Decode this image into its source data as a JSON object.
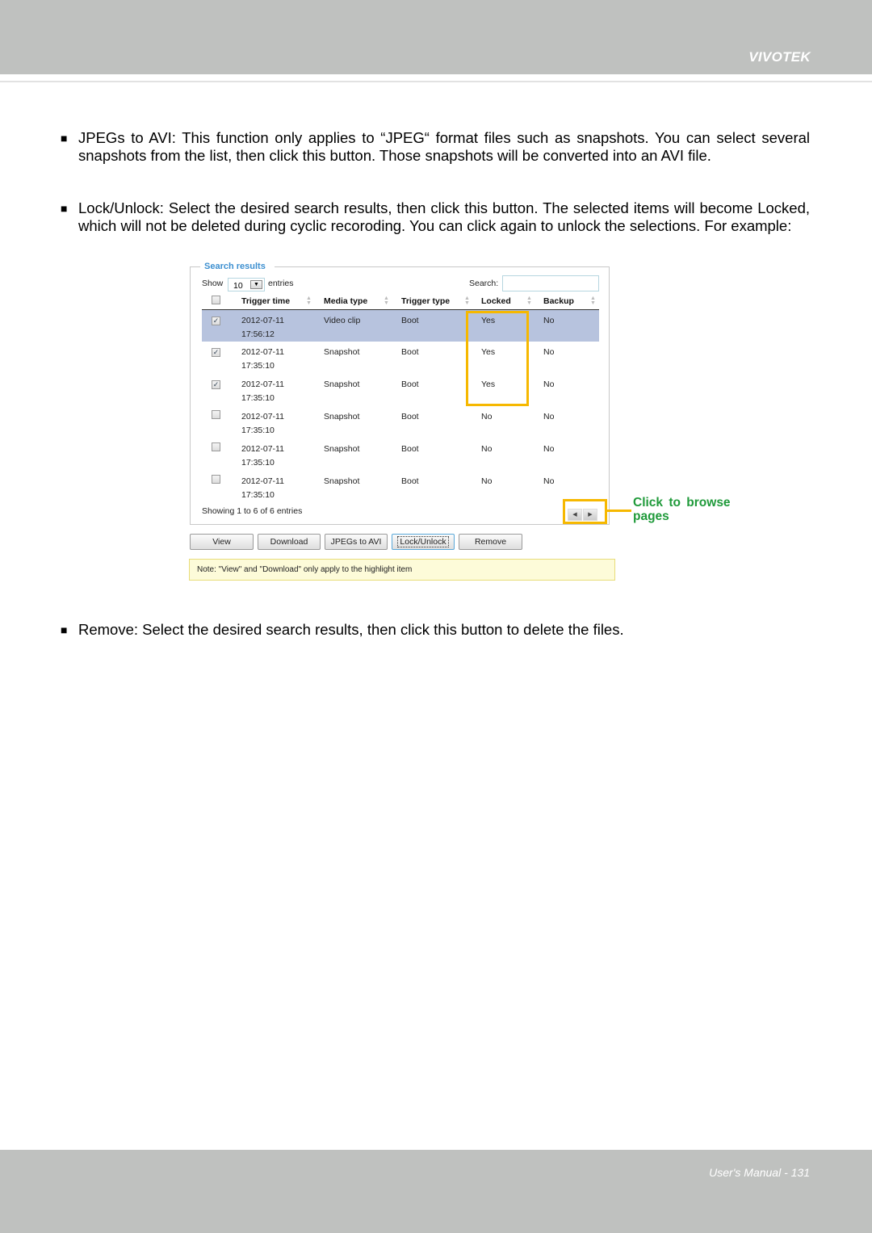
{
  "header": {
    "brand": "VIVOTEK"
  },
  "paragraphs": [
    {
      "bullet": "■",
      "text": "JPEGs to AVI: This function only applies to “JPEG“ format files such as snapshots. You can select several snapshots from the list, then click this button. Those snapshots will be converted into an AVI file."
    },
    {
      "bullet": "■",
      "text": "Lock/Unlock: Select the desired search results, then click this button. The selected items will become Locked, which will not be deleted during cyclic recoroding. You can click again to unlock the selections. For example:"
    },
    {
      "bullet": "■",
      "text": "Remove: Select the desired search results, then click this button to delete the files."
    }
  ],
  "search_panel": {
    "title": "Search results",
    "show_label": "Show",
    "entries_value": "10",
    "entries_label": "entries",
    "search_label": "Search:",
    "search_value": "",
    "columns": [
      "Trigger time",
      "Media type",
      "Trigger type",
      "Locked",
      "Backup"
    ],
    "rows": [
      {
        "checked": "✓",
        "date": "2012-07-11",
        "time": "17:56:12",
        "media": "Video clip",
        "trigger": "Boot",
        "locked": "Yes",
        "backup": "No"
      },
      {
        "checked": "✓",
        "date": "2012-07-11",
        "time": "17:35:10",
        "media": "Snapshot",
        "trigger": "Boot",
        "locked": "Yes",
        "backup": "No"
      },
      {
        "checked": "✓",
        "date": "2012-07-11",
        "time": "17:35:10",
        "media": "Snapshot",
        "trigger": "Boot",
        "locked": "Yes",
        "backup": "No"
      },
      {
        "checked": "",
        "date": "2012-07-11",
        "time": "17:35:10",
        "media": "Snapshot",
        "trigger": "Boot",
        "locked": "No",
        "backup": "No"
      },
      {
        "checked": "",
        "date": "2012-07-11",
        "time": "17:35:10",
        "media": "Snapshot",
        "trigger": "Boot",
        "locked": "No",
        "backup": "No"
      },
      {
        "checked": "",
        "date": "2012-07-11",
        "time": "17:35:10",
        "media": "Snapshot",
        "trigger": "Boot",
        "locked": "No",
        "backup": "No"
      }
    ],
    "showing_info": "Showing 1 to 6 of 6 entries",
    "pager": {
      "prev": "◀",
      "next": "▶"
    }
  },
  "callout": {
    "line1": "Click to browse",
    "line2": "pages"
  },
  "buttons": {
    "view": "View",
    "download": "Download",
    "jpegs_to_avi": "JPEGs to AVI",
    "lock_unlock": "Lock/Unlock",
    "remove": "Remove"
  },
  "note": "Note: \"View\" and \"Download\" only apply to the highlight item",
  "footer": {
    "page_label": "User's Manual - 131"
  }
}
